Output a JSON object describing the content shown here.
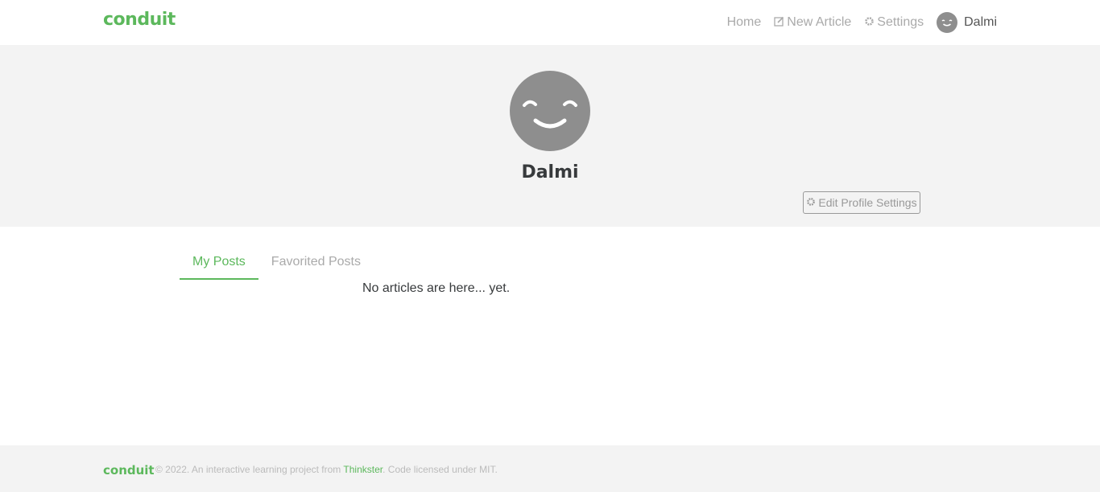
{
  "nav": {
    "brand": "conduit",
    "home": "Home",
    "new_article": "New Article",
    "settings": "Settings",
    "username": "Dalmi",
    "icons": [
      "compose-icon",
      "gear-icon",
      "avatar"
    ]
  },
  "profile": {
    "name": "Dalmi",
    "edit_button": "Edit Profile Settings"
  },
  "tabs": {
    "my_posts": "My Posts",
    "favorited_posts": "Favorited Posts",
    "active": "My Posts"
  },
  "articles": {
    "empty_message": "No articles are here... yet."
  },
  "footer": {
    "brand": "conduit",
    "prefix": "© 2022. An interactive learning project from ",
    "link": "Thinkster",
    "suffix": ". Code licensed under MIT."
  },
  "colors": {
    "accent": "#5cb85c",
    "banner_bg": "#f3f3f3",
    "avatar_bg": "#8e8e8e"
  }
}
